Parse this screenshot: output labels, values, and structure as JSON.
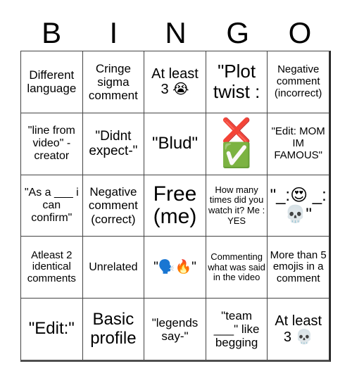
{
  "header": {
    "letters": [
      "B",
      "I",
      "N",
      "G",
      "O"
    ]
  },
  "board": {
    "rows": [
      [
        "Different language",
        "Cringe sigma comment",
        "At least 3 😭",
        "\"Plot twist :",
        "Negative comment (incorrect)"
      ],
      [
        "\"line from video\" -creator",
        "\"Didnt expect-\"",
        "\"Blud\"",
        "❌ ✅",
        "\"Edit: MOM IM FAMOUS\""
      ],
      [
        "\"As a ___ i can confirm\"",
        "Negative comment (correct)",
        "Free (me)",
        "How many times did you watch it? Me : YES",
        "\"_:😍 _:💀\""
      ],
      [
        "Atleast 2 identical comments",
        "Unrelated",
        "\"🗣️🔥\"",
        "Commenting what was said in the video",
        "More than 5 emojis in a comment"
      ],
      [
        "\"Edit:\"",
        "Basic profile",
        "\"legends say-\"",
        "\"team ___\" like begging",
        "At least 3 💀"
      ]
    ]
  }
}
